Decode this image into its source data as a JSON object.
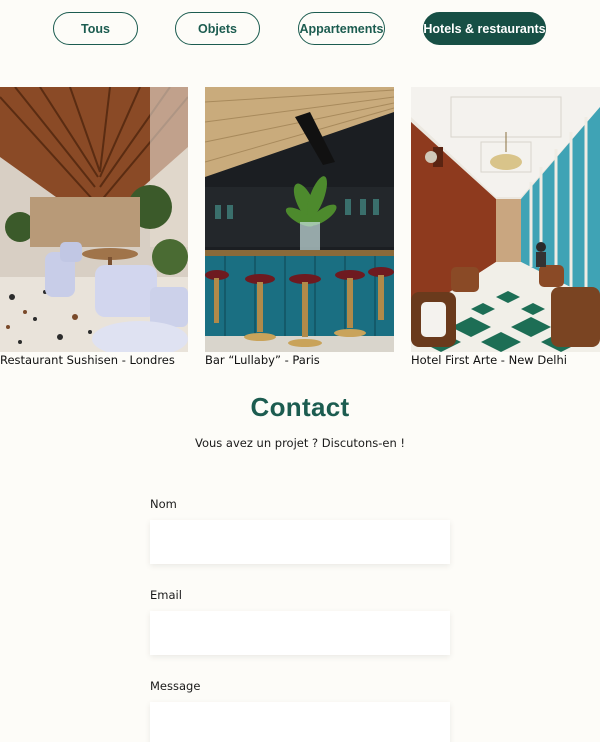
{
  "filters": [
    {
      "label": "Tous",
      "active": false
    },
    {
      "label": "Objets",
      "active": false
    },
    {
      "label": "Appartements",
      "active": false
    },
    {
      "label": "Hotels & restaurants",
      "active": true
    }
  ],
  "gallery": [
    {
      "caption": "Restaurant Sushisen - Londres",
      "image": "restaurant-interior-photo"
    },
    {
      "caption": "Bar “Lullaby” - Paris",
      "image": "bar-interior-photo"
    },
    {
      "caption": "Hotel First Arte - New Delhi",
      "image": "hotel-lobby-photo"
    }
  ],
  "contact": {
    "title": "Contact",
    "subtitle": "Vous avez un projet ? Discutons-en !",
    "fields": [
      {
        "label": "Nom",
        "value": ""
      },
      {
        "label": "Email",
        "value": ""
      },
      {
        "label": "Message",
        "value": ""
      }
    ]
  },
  "colors": {
    "accent": "#1c5c50",
    "active_button": "#174f45",
    "background": "#fdfcf8"
  }
}
